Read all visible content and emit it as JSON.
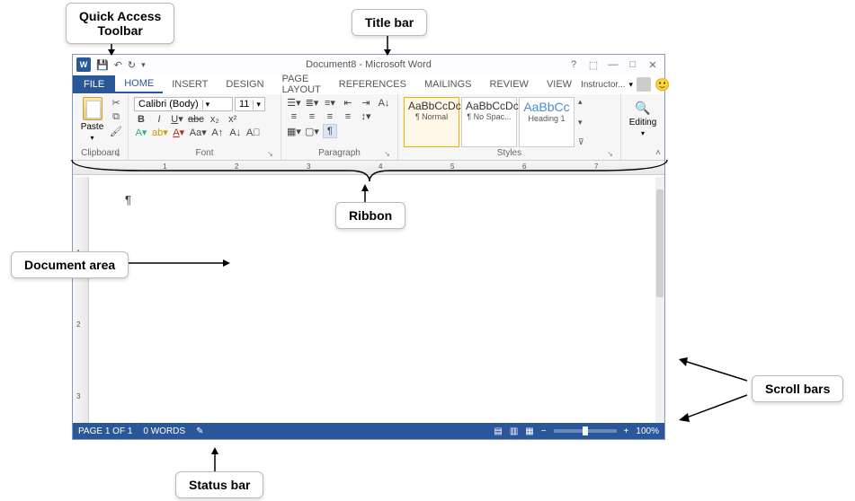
{
  "annotations": {
    "qat": "Quick Access\nToolbar",
    "titlebar": "Title bar",
    "ribbon": "Ribbon",
    "docarea": "Document area",
    "scroll": "Scroll bars",
    "status": "Status bar"
  },
  "title": "Document8 - Microsoft Word",
  "tabs": [
    "FILE",
    "HOME",
    "INSERT",
    "DESIGN",
    "PAGE LAYOUT",
    "REFERENCES",
    "MAILINGS",
    "REVIEW",
    "VIEW"
  ],
  "tabs_active_index": 1,
  "tabs_right": "Instructor...",
  "ribbon": {
    "clipboard": {
      "label": "Clipboard",
      "paste": "Paste"
    },
    "font": {
      "label": "Font",
      "name": "Calibri (Body)",
      "size": "11"
    },
    "paragraph": {
      "label": "Paragraph"
    },
    "styles": {
      "label": "Styles",
      "items": [
        {
          "preview": "AaBbCcDc",
          "name": "¶ Normal"
        },
        {
          "preview": "AaBbCcDc",
          "name": "¶ No Spac..."
        },
        {
          "preview": "AaBbCc",
          "name": "Heading 1"
        }
      ]
    },
    "editing": {
      "label": "Editing"
    }
  },
  "ruler_h": [
    "1",
    "2",
    "3",
    "4",
    "5",
    "6",
    "7"
  ],
  "ruler_v": [
    "1",
    "2",
    "3"
  ],
  "statusbar": {
    "page": "PAGE 1 OF 1",
    "words": "0 WORDS",
    "zoom": "100%"
  }
}
